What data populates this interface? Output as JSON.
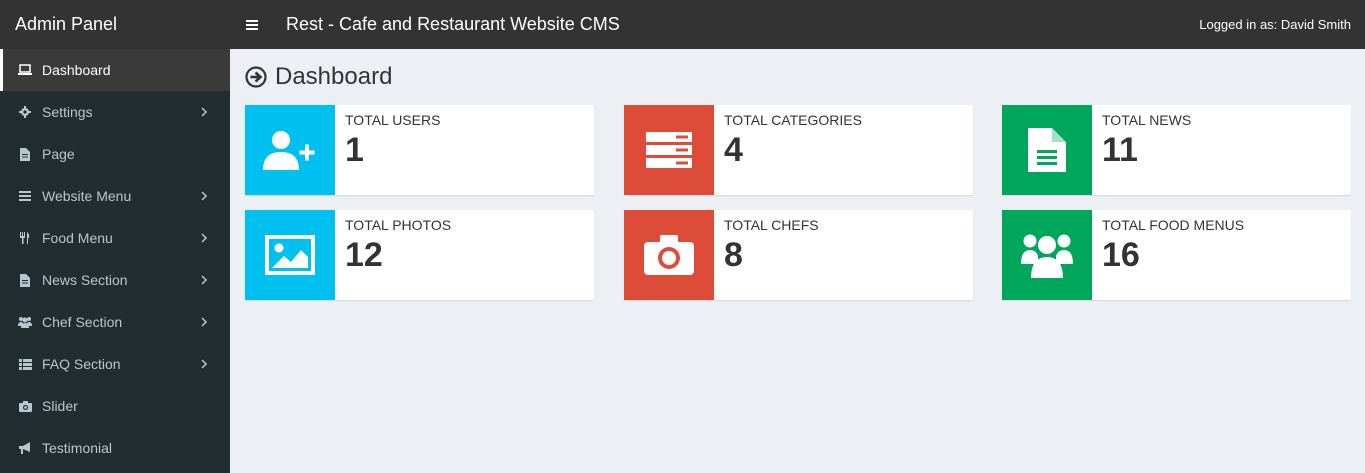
{
  "header": {
    "brand": "Admin Panel",
    "app_title": "Rest - Cafe and Restaurant Website CMS",
    "logged_in": "Logged in as: David Smith"
  },
  "sidebar": {
    "items": [
      {
        "label": "Dashboard",
        "icon": "laptop-icon",
        "active": true
      },
      {
        "label": "Settings",
        "icon": "gear-icon",
        "has_children": true
      },
      {
        "label": "Page",
        "icon": "file-icon"
      },
      {
        "label": "Website Menu",
        "icon": "bars-icon",
        "has_children": true
      },
      {
        "label": "Food Menu",
        "icon": "utensils-icon",
        "has_children": true
      },
      {
        "label": "News Section",
        "icon": "file-icon",
        "has_children": true
      },
      {
        "label": "Chef Section",
        "icon": "users-icon",
        "has_children": true
      },
      {
        "label": "FAQ Section",
        "icon": "list-icon",
        "has_children": true
      },
      {
        "label": "Slider",
        "icon": "camera-icon"
      },
      {
        "label": "Testimonial",
        "icon": "bullhorn-icon"
      }
    ]
  },
  "main": {
    "title": "Dashboard",
    "boxes": [
      {
        "label": "TOTAL USERS",
        "value": "1",
        "color": "#00c0ef",
        "icon": "user-plus-icon"
      },
      {
        "label": "TOTAL CATEGORIES",
        "value": "4",
        "color": "#dd4b39",
        "icon": "server-icon"
      },
      {
        "label": "TOTAL NEWS",
        "value": "11",
        "color": "#00a65a",
        "icon": "file-text-icon"
      },
      {
        "label": "TOTAL PHOTOS",
        "value": "12",
        "color": "#00c0ef",
        "icon": "image-icon"
      },
      {
        "label": "TOTAL CHEFS",
        "value": "8",
        "color": "#dd4b39",
        "icon": "camera-icon"
      },
      {
        "label": "TOTAL FOOD MENUS",
        "value": "16",
        "color": "#00a65a",
        "icon": "users-icon"
      }
    ]
  }
}
